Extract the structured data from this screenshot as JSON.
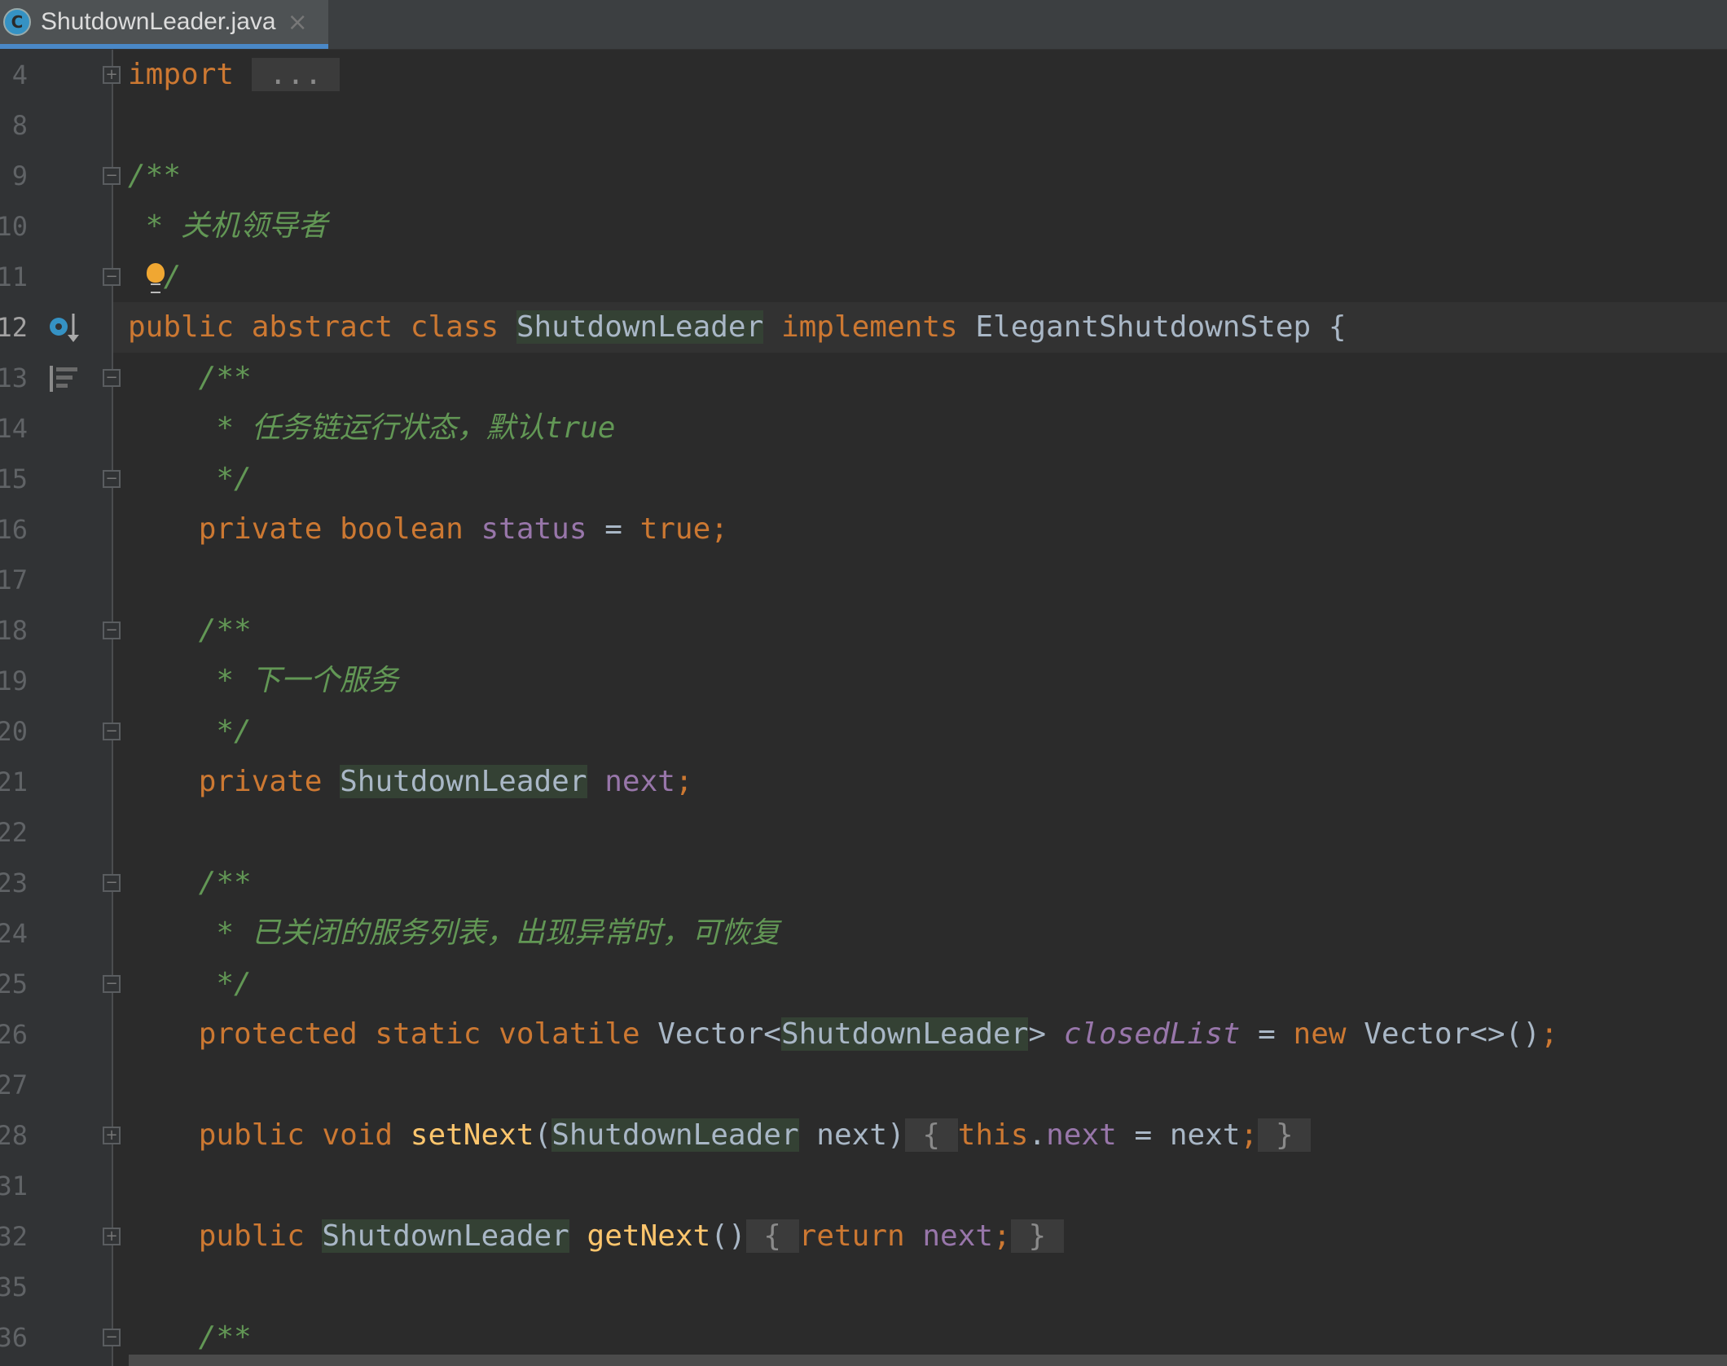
{
  "tab": {
    "icon": "class-icon",
    "icon_letter": "C",
    "title": "ShutdownLeader.java",
    "close": "×"
  },
  "colors": {
    "keyword": "#cc7832",
    "doc_comment": "#629755",
    "identifier": "#a9b7c6",
    "field": "#9876aa",
    "method": "#ffc66d",
    "usage_highlight": "#344134",
    "tab_underline": "#4a88c7"
  },
  "current_line": "12",
  "lines": [
    {
      "n": "4",
      "fold": "plus",
      "tokens": [
        {
          "t": "import",
          "c": "kw"
        },
        {
          "t": " "
        },
        {
          "t": " ... ",
          "c": "dim fb"
        }
      ]
    },
    {
      "n": "8",
      "tokens": []
    },
    {
      "n": "9",
      "fold": "open",
      "tokens": [
        {
          "t": "/**",
          "c": "doc"
        }
      ]
    },
    {
      "n": "10",
      "tokens": [
        {
          "t": " * 关机领导者",
          "c": "doc"
        }
      ]
    },
    {
      "n": "11",
      "fold": "close",
      "bulb": true,
      "tokens": [
        {
          "t": "/",
          "c": "doc"
        }
      ]
    },
    {
      "n": "12",
      "gicon": "implements-icon",
      "tokens": [
        {
          "t": "public abstract class ",
          "c": "kw"
        },
        {
          "t": "ShutdownLeader",
          "c": "id hl"
        },
        {
          "t": " implements ",
          "c": "kw"
        },
        {
          "t": "ElegantShutdownStep {",
          "c": "id"
        }
      ]
    },
    {
      "n": "13",
      "gicon": "structure-icon",
      "fold": "open",
      "tokens": [
        {
          "t": "    /**",
          "c": "doc"
        }
      ]
    },
    {
      "n": "14",
      "tokens": [
        {
          "t": "     * 任务链运行状态，默认true",
          "c": "doc"
        }
      ]
    },
    {
      "n": "15",
      "fold": "close",
      "tokens": [
        {
          "t": "     */",
          "c": "doc"
        }
      ]
    },
    {
      "n": "16",
      "tokens": [
        {
          "t": "    private boolean ",
          "c": "kw"
        },
        {
          "t": "status",
          "c": "fld"
        },
        {
          "t": " = ",
          "c": "id"
        },
        {
          "t": "true;",
          "c": "kw"
        }
      ]
    },
    {
      "n": "17",
      "tokens": []
    },
    {
      "n": "18",
      "fold": "open",
      "tokens": [
        {
          "t": "    /**",
          "c": "doc"
        }
      ]
    },
    {
      "n": "19",
      "tokens": [
        {
          "t": "     * 下一个服务",
          "c": "doc"
        }
      ]
    },
    {
      "n": "20",
      "fold": "close",
      "tokens": [
        {
          "t": "     */",
          "c": "doc"
        }
      ]
    },
    {
      "n": "21",
      "tokens": [
        {
          "t": "    private ",
          "c": "kw"
        },
        {
          "t": "ShutdownLeader",
          "c": "id hl"
        },
        {
          "t": " "
        },
        {
          "t": "next",
          "c": "fld"
        },
        {
          "t": ";",
          "c": "kw"
        }
      ]
    },
    {
      "n": "22",
      "tokens": []
    },
    {
      "n": "23",
      "fold": "open",
      "tokens": [
        {
          "t": "    /**",
          "c": "doc"
        }
      ]
    },
    {
      "n": "24",
      "tokens": [
        {
          "t": "     * 已关闭的服务列表，出现异常时，可恢复",
          "c": "doc"
        }
      ]
    },
    {
      "n": "25",
      "fold": "close",
      "tokens": [
        {
          "t": "     */",
          "c": "doc"
        }
      ]
    },
    {
      "n": "26",
      "tokens": [
        {
          "t": "    protected static volatile ",
          "c": "kw"
        },
        {
          "t": "Vector<",
          "c": "id"
        },
        {
          "t": "ShutdownLeader",
          "c": "id hl"
        },
        {
          "t": "> ",
          "c": "id"
        },
        {
          "t": "closedList",
          "c": "fldi"
        },
        {
          "t": " = ",
          "c": "id"
        },
        {
          "t": "new ",
          "c": "kw"
        },
        {
          "t": "Vector<>()",
          "c": "id"
        },
        {
          "t": ";",
          "c": "kw"
        }
      ]
    },
    {
      "n": "27",
      "tokens": []
    },
    {
      "n": "28",
      "fold": "plus",
      "tokens": [
        {
          "t": "    public void ",
          "c": "kw"
        },
        {
          "t": "setNext",
          "c": "mth"
        },
        {
          "t": "(",
          "c": "id"
        },
        {
          "t": "ShutdownLeader",
          "c": "id hl"
        },
        {
          "t": " next)",
          "c": "id"
        },
        {
          "t": " { ",
          "c": "dim fb"
        },
        {
          "t": "this",
          "c": "kw"
        },
        {
          "t": ".",
          "c": "id"
        },
        {
          "t": "next",
          "c": "fld"
        },
        {
          "t": " = next",
          "c": "id"
        },
        {
          "t": ";",
          "c": "kw"
        },
        {
          "t": " } ",
          "c": "dim fb"
        }
      ]
    },
    {
      "n": "31",
      "tokens": []
    },
    {
      "n": "32",
      "fold": "plus",
      "tokens": [
        {
          "t": "    public ",
          "c": "kw"
        },
        {
          "t": "ShutdownLeader",
          "c": "id hl"
        },
        {
          "t": " "
        },
        {
          "t": "getNext",
          "c": "mth"
        },
        {
          "t": "()",
          "c": "id"
        },
        {
          "t": " { ",
          "c": "dim fb"
        },
        {
          "t": "return ",
          "c": "kw"
        },
        {
          "t": "next",
          "c": "fld"
        },
        {
          "t": ";",
          "c": "kw"
        },
        {
          "t": " } ",
          "c": "dim fb"
        }
      ]
    },
    {
      "n": "35",
      "tokens": []
    },
    {
      "n": "36",
      "fold": "open",
      "tokens": [
        {
          "t": "    /**",
          "c": "doc"
        }
      ]
    }
  ]
}
